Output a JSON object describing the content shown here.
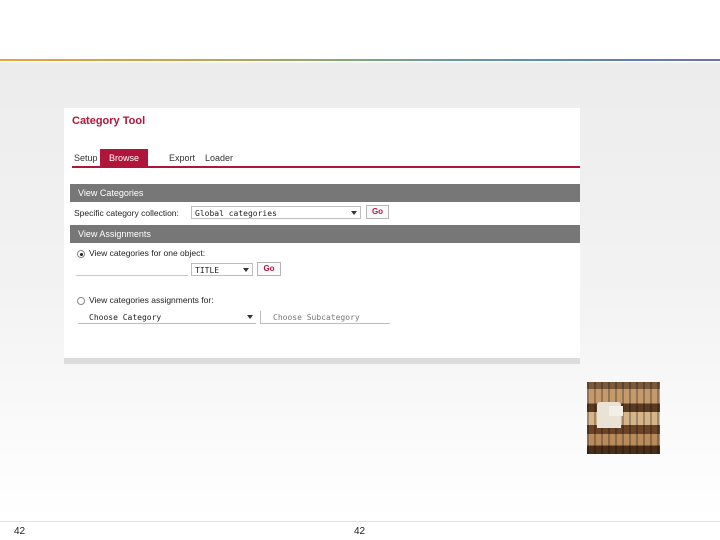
{
  "tool": {
    "title": "Category Tool",
    "tabs": [
      {
        "label": "Setup",
        "active": false
      },
      {
        "label": "Browse",
        "active": true
      },
      {
        "label": "Export",
        "active": false
      },
      {
        "label": "Loader",
        "active": false
      }
    ],
    "accent_color": "#b0163a",
    "section_bar_color": "#777777"
  },
  "view_categories": {
    "heading": "View Categories",
    "collection_label": "Specific category collection:",
    "collection_value": "Global categories",
    "go_label": "Go"
  },
  "view_assignments": {
    "heading": "View Assignments",
    "option1_label": "View categories for one object:",
    "option1_selected": true,
    "object_input_value": "",
    "type_value": "TITLE",
    "go_label": "Go",
    "option2_label": "View categories assignments for:",
    "option2_selected": false,
    "category_value": "Choose Category",
    "subcategory_value": "Choose Subcategory"
  },
  "footer": {
    "left_page_number": "42",
    "center_page_number": "42"
  },
  "photo": {
    "icon": "library-bookshelf-photo"
  }
}
